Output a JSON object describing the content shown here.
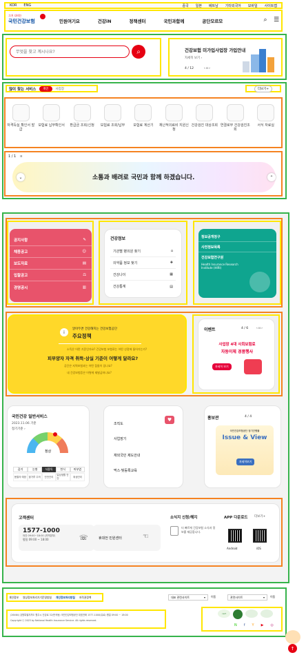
{
  "topbar": {
    "items": [
      "KOR",
      "ENG",
      "중국",
      "일본",
      "베트남",
      "기타외국어",
      "모바일",
      "사이트맵"
    ]
  },
  "header": {
    "logo_small": "그거 너라는",
    "logo": "국민건강보험",
    "nav": [
      "민원여기요",
      "건강iN",
      "정책센터",
      "국민과함께",
      "공단모르모"
    ],
    "search_icon": "search-icon",
    "menu_icon": "hamburger-icon"
  },
  "search": {
    "placeholder": "무엇을 찾고 계시나요?"
  },
  "banner": {
    "title": "건강보험 미가입사업장 가입안내",
    "link": "자세히 보기 ›",
    "counter": "4 / 12",
    "controls": "‹ ıı ›"
  },
  "quick": {
    "title": "많이 찾는 서비스",
    "tab_active": "개인",
    "tab_other": "사업장",
    "more": "더보기+",
    "items": [
      "자격득실 확인서 발급",
      "보험료 납부확인서",
      "환급금 조회/신청",
      "보험료 조회/납부",
      "보험료 계산기",
      "재난적의료비 지원신청",
      "건강검진 대상조회",
      "연결로부 건강검진조회",
      "서식 자료실"
    ]
  },
  "slogan": {
    "counter": "1 / 1",
    "pause": "ıı",
    "text": "소통과 배려로 국민과 함께 하겠습니다."
  },
  "notices": {
    "items": [
      "공지사항",
      "채용공고",
      "보도자료",
      "입찰공고",
      "경영공시"
    ]
  },
  "health": {
    "title": "건강정보",
    "items": [
      "기관별 병의원 찾기",
      "의약품 정보 찾기",
      "건강나이",
      "건강통계"
    ]
  },
  "teal": {
    "items": [
      "정보공개청구",
      "사전정보목록",
      "건강보험연구원"
    ],
    "sub": "Health Insurance Research Institute (HIRI)"
  },
  "policy": {
    "kicker": "알아두면 건강해지는 건강보험공단",
    "title": "주요정책",
    "q_main": "피부양자 자격 취득·상실 기준이 어떻게 달라요?",
    "q1": "소득은 어떤 기준인가요? 건강보험 보험료는 어떤 산정에 들어가는가?",
    "q2": "공단은 지역보험과는 어떤 점들이 있나요?",
    "q3": "내 건강보험증은 어떻게 재발급하나요?"
  },
  "event": {
    "title": "이벤트",
    "counter": "4 / 6",
    "controls": "‹ ıı ›",
    "line1": "사업장 4대 사회보험료",
    "line2": "자동이체 경품행사",
    "cta": "자세히 보기"
  },
  "service": {
    "title": "국민건강 일반서비스",
    "date": "2023.11.06 기준",
    "sub": "정기기준 ›",
    "grade": "정상",
    "tabs": [
      "감기",
      "눈병",
      "식중독",
      "천식",
      "피부염"
    ],
    "tab_active": 2,
    "cells": [
      "봄철의 예방",
      "꽃가루 주의",
      "안전관리",
      "일상생활 안전",
      "위생관리"
    ]
  },
  "links": {
    "items": [
      "조직도",
      "사업장기",
      "재외국민 제도안내",
      "먹스·빛등록교육"
    ]
  },
  "promo": {
    "title": "홍보관",
    "counter": "4 / 4",
    "kicker": "국민건강보험공단 정기간행물",
    "line": "Issue & View",
    "cta": "자세히보기"
  },
  "customer": {
    "title": "고객센터",
    "phone": "1577-1000",
    "hours1": "평일 09:00 ~ 18:00",
    "hours2": "야간 09:00~18:00 (지역본부)",
    "center": "휴대전 민원센터",
    "complaint_title": "소식지 신청/해지",
    "complaint_text": "더 빠르게 건강보험 소식과 정보를 제공합니다.",
    "app_title": "APP 다운로드",
    "app_more": "더보기+",
    "android": "Android",
    "ios": "iOS"
  },
  "footer": {
    "links": [
      "개인정보",
      "영상정보처리기기운영방침",
      "개인정보처리방침",
      "저작권정책"
    ],
    "select1": "대표 관련사이트",
    "select2": "관련사이트",
    "go": "이동",
    "address": "(26464) 강원특별자치도 원주시 건강로 32(반곡동) 국민건강보험공단 대표전화 1577-1000(유료) 평일 09:00 ~ 18:00",
    "copyright": "Copyright ⓒ 2023 by National Health Insurance Service. All rights reserved.",
    "cert": "인증마크",
    "social": [
      "N",
      "f",
      "Y",
      "▶",
      "◎"
    ]
  },
  "colors": {
    "red": "#e8536b",
    "teal": "#0fa58f",
    "yellow": "#ffd829",
    "brand": "#e60012"
  }
}
